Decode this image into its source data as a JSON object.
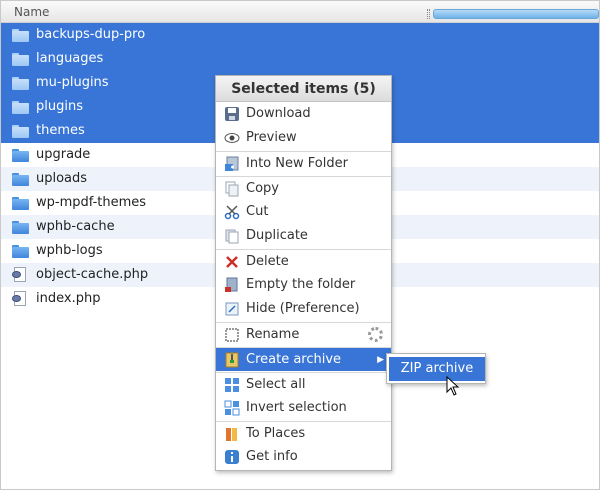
{
  "header": {
    "column_name": "Name"
  },
  "files": [
    {
      "name": "backups-dup-pro",
      "type": "folder",
      "selected": true
    },
    {
      "name": "languages",
      "type": "folder",
      "selected": true
    },
    {
      "name": "mu-plugins",
      "type": "folder",
      "selected": true
    },
    {
      "name": "plugins",
      "type": "folder",
      "selected": true
    },
    {
      "name": "themes",
      "type": "folder",
      "selected": true
    },
    {
      "name": "upgrade",
      "type": "folder",
      "selected": false
    },
    {
      "name": "uploads",
      "type": "folder",
      "selected": false
    },
    {
      "name": "wp-mpdf-themes",
      "type": "folder",
      "selected": false
    },
    {
      "name": "wphb-cache",
      "type": "folder",
      "selected": false
    },
    {
      "name": "wphb-logs",
      "type": "folder",
      "selected": false
    },
    {
      "name": "object-cache.php",
      "type": "php",
      "selected": false
    },
    {
      "name": "index.php",
      "type": "php",
      "selected": false
    }
  ],
  "context_menu": {
    "title": "Selected items (5)",
    "items": [
      {
        "label": "Download",
        "icon": "download-icon"
      },
      {
        "label": "Preview",
        "icon": "eye-icon"
      },
      {
        "label": "Into New Folder",
        "icon": "new-folder-icon"
      },
      {
        "label": "Copy",
        "icon": "copy-icon"
      },
      {
        "label": "Cut",
        "icon": "scissors-icon"
      },
      {
        "label": "Duplicate",
        "icon": "duplicate-icon"
      },
      {
        "label": "Delete",
        "icon": "delete-icon"
      },
      {
        "label": "Empty the folder",
        "icon": "empty-folder-icon"
      },
      {
        "label": "Hide (Preference)",
        "icon": "hide-icon"
      },
      {
        "label": "Rename",
        "icon": "rename-icon"
      },
      {
        "label": "Create archive",
        "icon": "archive-icon"
      },
      {
        "label": "Select all",
        "icon": "select-all-icon"
      },
      {
        "label": "Invert selection",
        "icon": "invert-selection-icon"
      },
      {
        "label": "To Places",
        "icon": "places-icon"
      },
      {
        "label": "Get info",
        "icon": "info-icon"
      }
    ]
  },
  "submenu": {
    "zip_label": "ZIP archive"
  },
  "colors": {
    "selection": "#3875d7",
    "folder": "#3f86db"
  }
}
